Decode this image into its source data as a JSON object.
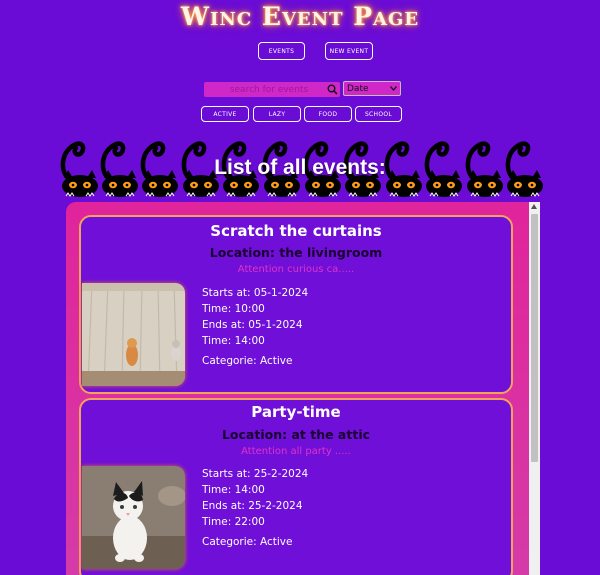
{
  "header": {
    "title": "Winc Event Page"
  },
  "nav": {
    "events_label": "EVENTS",
    "new_event_label": "NEW EVENT"
  },
  "filters": {
    "search_placeholder": "search for events",
    "sort_selected": "Date",
    "categories": [
      "ACTIVE",
      "LAZY",
      "FOOD",
      "SCHOOL"
    ]
  },
  "list": {
    "title": "List of all events:"
  },
  "events": [
    {
      "title": "Scratch the curtains",
      "location": "Location: the livingroom",
      "description": "Attention curious ca.....",
      "starts": "Starts at: 05-1-2024",
      "start_time": "Time: 10:00",
      "ends": "Ends at: 05-1-2024",
      "end_time": "Time: 14:00",
      "category": "Categorie: Active"
    },
    {
      "title": "Party-time",
      "location": "Location: at the attic",
      "description": "Attention all party .....",
      "starts": "Starts at: 25-2-2024",
      "start_time": "Time: 14:00",
      "ends": "Ends at: 25-2-2024",
      "end_time": "Time: 22:00",
      "category": "Categorie: Active"
    }
  ],
  "colors": {
    "background": "#6a0bd6",
    "panel": "#e0249c",
    "card": "#6f0fd8",
    "card_border": "#f1a35a",
    "accent": "#cf27c8"
  }
}
